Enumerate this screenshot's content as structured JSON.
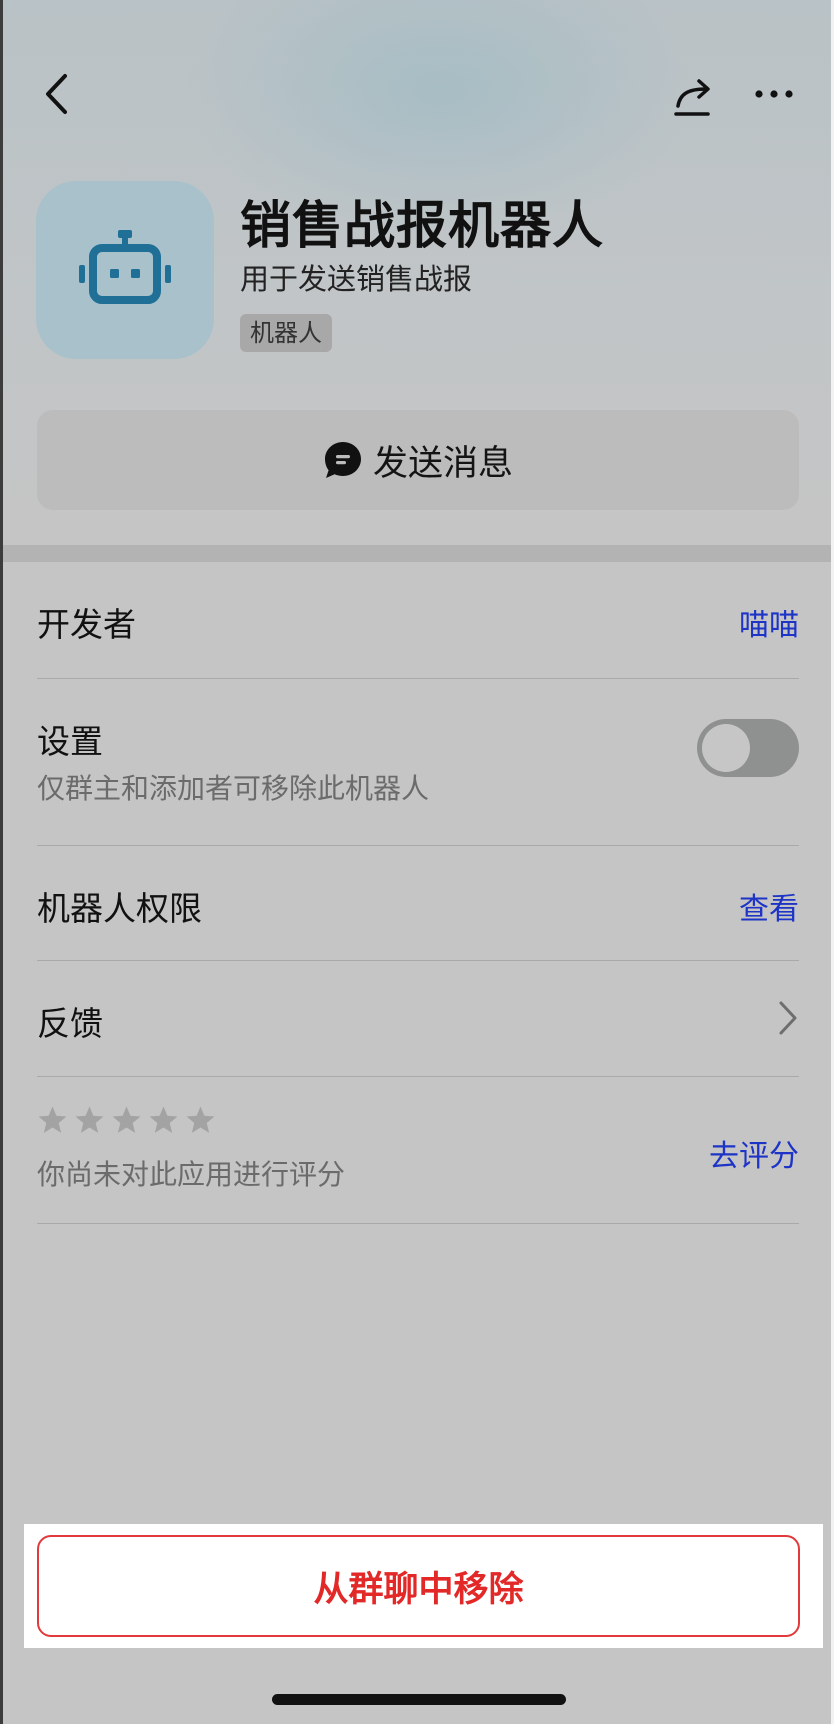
{
  "header": {
    "back_icon": "chevron-left-icon",
    "share_icon": "share-icon",
    "more_icon": "more-horizontal-icon"
  },
  "app": {
    "icon": "robot-icon",
    "icon_bg": "#a9c1cb",
    "icon_fg": "#1f6f96",
    "name": "销售战报机器人",
    "description": "用于发送销售战报",
    "tag": "机器人"
  },
  "send_button": {
    "icon": "chat-bubble-icon",
    "label": "发送消息"
  },
  "rows": {
    "developer": {
      "title": "开发者",
      "value": "喵喵"
    },
    "settings": {
      "title": "设置",
      "subtitle": "仅群主和添加者可移除此机器人",
      "toggle_on": false
    },
    "permissions": {
      "title": "机器人权限",
      "action": "查看"
    },
    "feedback": {
      "title": "反馈",
      "icon": "chevron-right-icon"
    },
    "rating": {
      "stars_filled": 0,
      "stars_total": 5,
      "subtitle": "你尚未对此应用进行评分",
      "action": "去评分"
    }
  },
  "remove_button": {
    "label": "从群聊中移除"
  },
  "colors": {
    "link": "#1d34c6",
    "danger": "#e32828"
  }
}
